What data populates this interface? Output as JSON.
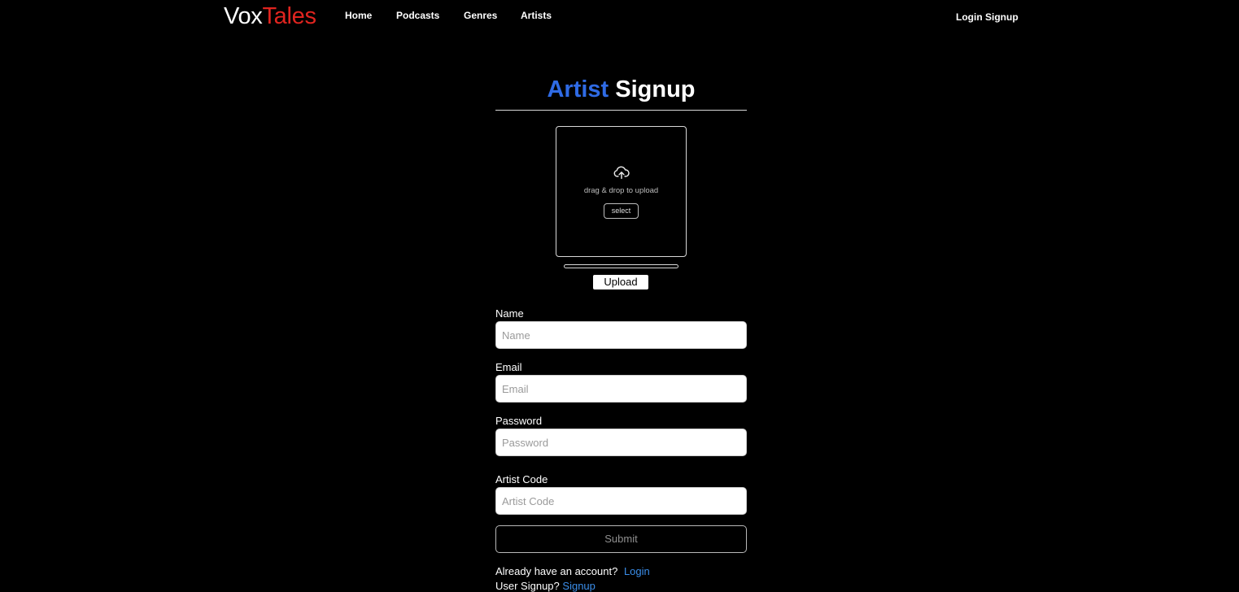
{
  "navbar": {
    "logo_part1": "Vox",
    "logo_part2": "Tales",
    "links": [
      "Home",
      "Podcasts",
      "Genres",
      "Artists"
    ],
    "login": "Login",
    "signup": "Signup"
  },
  "page": {
    "title_accent": "Artist",
    "title_rest": "Signup"
  },
  "uploader": {
    "icon": "cloud-upload-icon",
    "drop_text": "drag & drop to upload",
    "select_label": "select",
    "progress_percent": 0,
    "upload_label": "Upload"
  },
  "form": {
    "fields": [
      {
        "label": "Name",
        "placeholder": "Name",
        "value": ""
      },
      {
        "label": "Email",
        "placeholder": "Email",
        "value": ""
      },
      {
        "label": "Password",
        "placeholder": "Password",
        "value": ""
      },
      {
        "label": "Artist Code",
        "placeholder": "Artist Code",
        "value": ""
      }
    ],
    "submit_label": "Submit"
  },
  "footer": {
    "already_text": "Already have an account?",
    "login_link": "Login",
    "cut_text": "User Signup?",
    "cut_link": "Signup"
  },
  "colors": {
    "background": "#000000",
    "accent_blue": "#2f6be5",
    "logo_red": "#e0241f",
    "link_blue": "#3b8eea"
  }
}
